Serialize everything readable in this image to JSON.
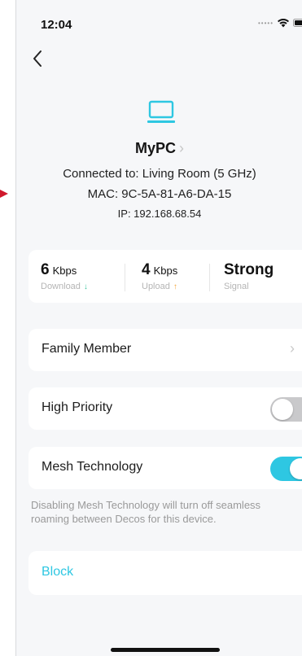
{
  "status_bar": {
    "time": "12:04",
    "signal_icon": "cell-dots-icon",
    "wifi_icon": "wifi-icon",
    "battery_icon": "battery-icon"
  },
  "nav": {
    "back_icon": "chevron-left-icon"
  },
  "device": {
    "icon": "laptop-icon",
    "name": "MyPC",
    "connected_to": "Connected to: Living Room (5 GHz)",
    "mac": "MAC: 9C-5A-81-A6-DA-15",
    "ip": "IP: 192.168.68.54"
  },
  "stats": {
    "download": {
      "value": "6",
      "unit": "Kbps",
      "label": "Download"
    },
    "upload": {
      "value": "4",
      "unit": "Kbps",
      "label": "Upload"
    },
    "signal": {
      "value": "Strong",
      "label": "Signal"
    }
  },
  "settings": {
    "family_member": {
      "label": "Family Member"
    },
    "high_priority": {
      "label": "High Priority",
      "enabled": false
    },
    "mesh_technology": {
      "label": "Mesh Technology",
      "enabled": true
    },
    "mesh_note": "Disabling Mesh Technology will turn off seamless roaming between Decos for this device."
  },
  "block": {
    "label": "Block"
  },
  "colors": {
    "accent": "#2ec7e2",
    "download_arrow": "#41c6a0",
    "upload_arrow": "#f3a63b",
    "toggle_off": "#c9c9cb",
    "annotation_arrow": "#d0192c"
  }
}
